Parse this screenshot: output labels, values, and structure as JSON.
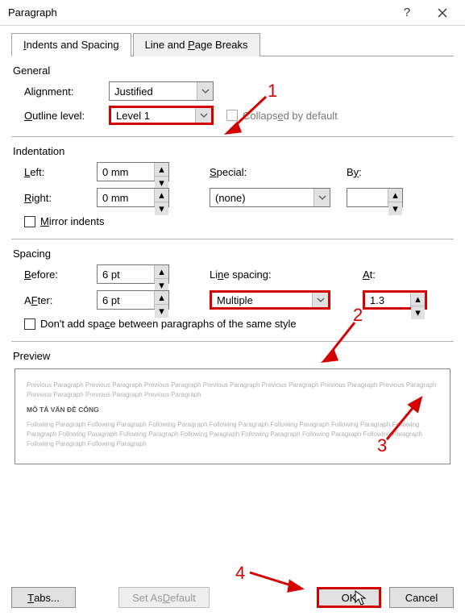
{
  "window": {
    "title": "Paragraph"
  },
  "tabs": {
    "tab1_prefix": "I",
    "tab1_rest": "ndents and Spacing",
    "tab2_prefix": "Line and ",
    "tab2_u": "P",
    "tab2_rest": "age Breaks"
  },
  "sections": {
    "general": "General",
    "indentation": "Indentation",
    "spacing": "Spacing",
    "preview": "Preview"
  },
  "general": {
    "alignment_prefix": "Ali",
    "alignment_u": "g",
    "alignment_rest": "nment:",
    "alignment_value": "Justified",
    "outline_u": "O",
    "outline_rest": "utline level:",
    "outline_value": "Level 1",
    "collapsed_prefix": "Collaps",
    "collapsed_u": "e",
    "collapsed_rest": "d by default"
  },
  "indent": {
    "left_u": "L",
    "left_rest": "eft:",
    "left_value": "0 mm",
    "right_u": "R",
    "right_rest": "ight:",
    "right_value": "0 mm",
    "special_u": "S",
    "special_rest": "pecial:",
    "special_value": "(none)",
    "by_prefix": "B",
    "by_u": "y",
    "by_rest": ":",
    "mirror_u": "M",
    "mirror_rest": "irror indents"
  },
  "spacing": {
    "before_u": "B",
    "before_rest": "efore:",
    "before_value": "6 pt",
    "after_u": "F",
    "after_prefix": "A",
    "after_rest": "ter:",
    "after_value": "6 pt",
    "line_prefix": "Li",
    "line_u": "n",
    "line_rest": "e spacing:",
    "line_value": "Multiple",
    "at_u": "A",
    "at_rest": "t:",
    "at_value": "1.3",
    "dontadd_prefix": "Don't add spa",
    "dontadd_u": "c",
    "dontadd_rest": "e between paragraphs of the same style"
  },
  "preview": {
    "grey1": "Previous Paragraph Previous Paragraph Previous Paragraph Previous Paragraph Previous Paragraph Previous Paragraph Previous Paragraph Previous Paragraph Previous Paragraph Previous Paragraph",
    "sample": "MÔ TẢ VẤN ĐỀ CÔNG",
    "grey2": "Following Paragraph Following Paragraph Following Paragraph Following Paragraph Following Paragraph Following Paragraph Following Paragraph Following Paragraph Following Paragraph Following Paragraph Following Paragraph Following Paragraph Following Paragraph Following Paragraph Following Paragraph"
  },
  "buttons": {
    "tabs_u": "T",
    "tabs_rest": "abs...",
    "default_prefix": "Set As ",
    "default_u": "D",
    "default_rest": "efault",
    "ok": "OK",
    "cancel": "Cancel"
  },
  "annotations": {
    "n1": "1",
    "n2": "2",
    "n3": "3",
    "n4": "4"
  }
}
